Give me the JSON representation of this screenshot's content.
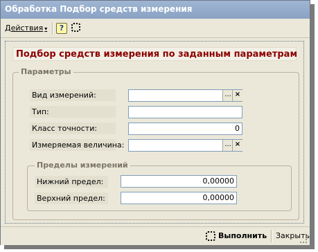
{
  "window": {
    "title": "Обработка  Подбор средств измерения"
  },
  "toolbar": {
    "actions_label": "Действия",
    "actions_arrow": "▾",
    "help_label": "?"
  },
  "form": {
    "header": "Подбор средств измерения по заданным параметрам",
    "params_group": {
      "legend": "Параметры",
      "fields": [
        {
          "label": "Вид измерений:",
          "value": ""
        },
        {
          "label": "Тип:",
          "value": ""
        },
        {
          "label": "Класс точности:",
          "value": "0"
        },
        {
          "label": "Измеряемая величина:",
          "value": ""
        }
      ]
    },
    "limits_group": {
      "legend": "Пределы измерений",
      "fields": [
        {
          "label": "Нижний предел:",
          "value": "0,00000"
        },
        {
          "label": "Верхний предел:",
          "value": "0,00000"
        }
      ]
    },
    "select_button_label": "...",
    "clear_button_label": "×"
  },
  "bottombar": {
    "run_label": "Выполнить",
    "close_label": "Закрыть"
  }
}
